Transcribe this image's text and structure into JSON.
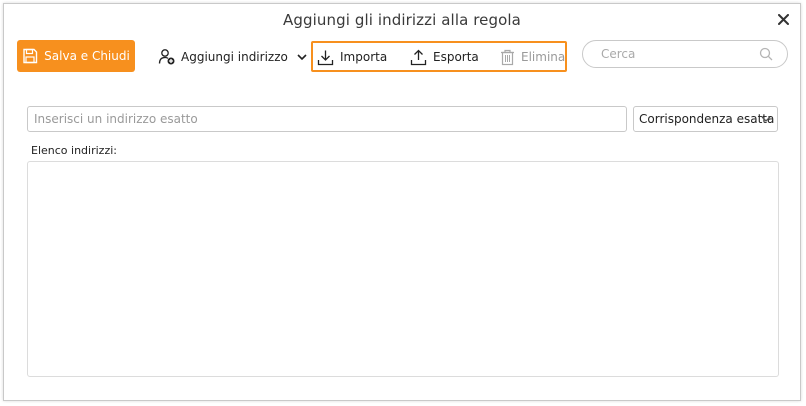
{
  "dialog": {
    "title": "Aggiungi gli indirizzi alla regola"
  },
  "toolbar": {
    "save_label": "Salva e Chiudi",
    "add_address_label": "Aggiungi indirizzo",
    "import_label": "Importa",
    "export_label": "Esporta",
    "delete_label": "Elimina"
  },
  "search": {
    "placeholder": "Cerca"
  },
  "address_input": {
    "placeholder": "Inserisci un indirizzo esatto",
    "value": ""
  },
  "match_select": {
    "selected": "Corrispondenza esatta"
  },
  "address_list": {
    "label": "Elenco indirizzi:",
    "items": []
  },
  "colors": {
    "accent": "#f7901e",
    "disabled_text": "#9a9a9a",
    "border": "#c9c9c9"
  },
  "icons": {
    "save": "floppy-disk-icon",
    "add_address": "add-user-icon",
    "import": "download-icon",
    "export": "upload-icon",
    "delete": "trash-icon",
    "search": "search-icon",
    "close": "close-icon"
  }
}
